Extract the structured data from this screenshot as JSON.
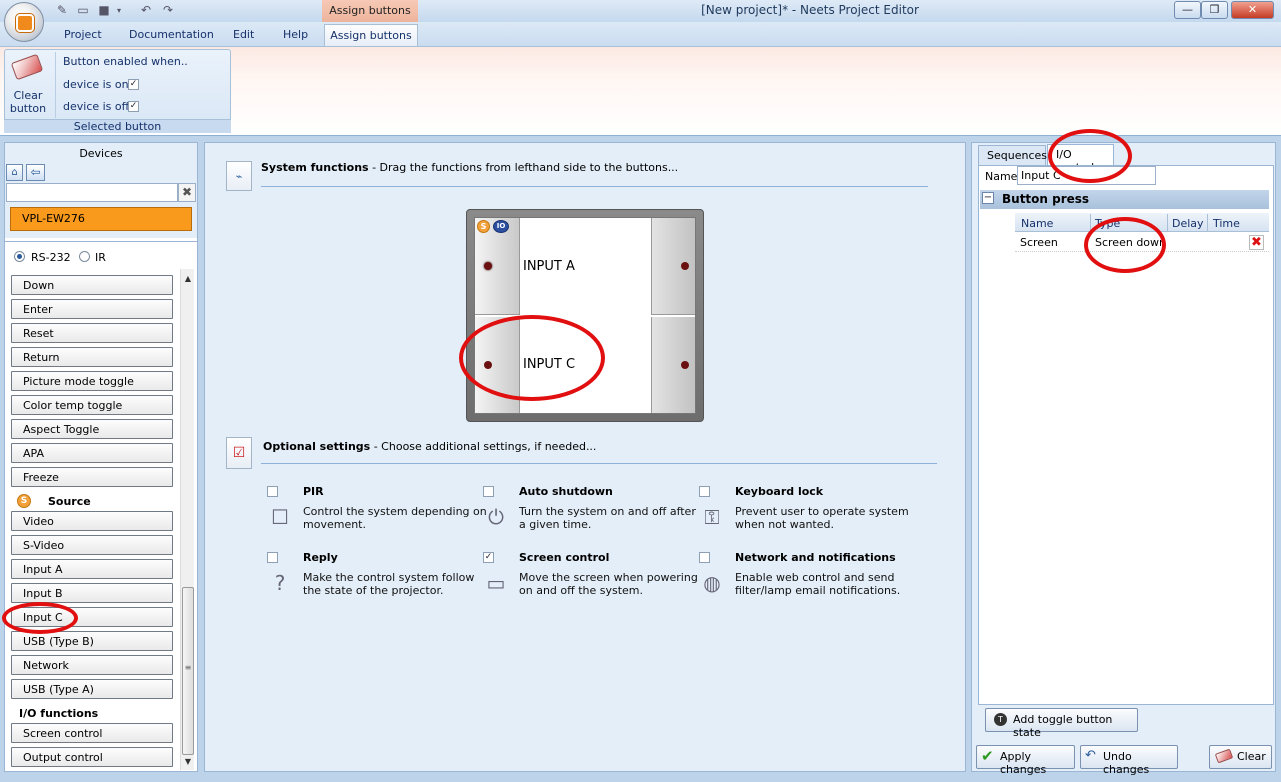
{
  "window": {
    "title": "[New project]* - Neets Project Editor",
    "context_tab": "Assign buttons",
    "min": "—",
    "max": "❐",
    "close": "✕"
  },
  "menu": {
    "items": [
      "Project",
      "Documentation",
      "Edit",
      "Help"
    ],
    "active": "Assign buttons"
  },
  "ribbon": {
    "clear_button": "Clear button",
    "clear_line1": "Clear",
    "clear_line2": "button",
    "enabled_when": "Button enabled when..",
    "device_on": "device is on",
    "device_off": "device is off",
    "group_label": "Selected button"
  },
  "devices": {
    "header": "Devices",
    "search_value": "",
    "clear_icon": "✖",
    "selected_device": "VPL-EW276",
    "radio_rs232": "RS-232",
    "radio_ir": "IR",
    "items1": [
      "Down",
      "Enter",
      "Reset",
      "Return",
      "Picture mode toggle",
      "Color temp toggle",
      "Aspect Toggle",
      "APA",
      "Freeze"
    ],
    "source_header": "Source",
    "source_items": [
      "Video",
      "S-Video",
      "Input A",
      "Input B",
      "Input C",
      "USB (Type B)",
      "Network",
      "USB (Type A)"
    ],
    "io_header": "I/O functions",
    "io_items": [
      "Screen control",
      "Output control"
    ]
  },
  "center": {
    "sys_title": "System functions",
    "sys_desc": " - Drag the functions from lefthand side to the buttons...",
    "panel_label_top": "INPUT A",
    "panel_label_bottom": "INPUT C",
    "badge_s": "S",
    "badge_io": "IO",
    "opt_title": "Optional settings",
    "opt_desc": " - Choose additional settings, if needed...",
    "options": [
      {
        "title": "PIR",
        "desc1": "Control the system depending on",
        "desc2": "movement.",
        "checked": false
      },
      {
        "title": "Auto shutdown",
        "desc1": "Turn the system on and off after",
        "desc2": "a given time.",
        "checked": false
      },
      {
        "title": "Keyboard lock",
        "desc1": "Prevent user to operate system",
        "desc2": "when not wanted.",
        "checked": false
      },
      {
        "title": "Reply",
        "desc1": "Make the control system follow",
        "desc2": "the state of the projector.",
        "checked": false
      },
      {
        "title": "Screen control",
        "desc1": "Move the screen when powering",
        "desc2": "on and off the system.",
        "checked": true
      },
      {
        "title": "Network and notifications",
        "desc1": "Enable web control and send",
        "desc2": "filter/lamp email notifications.",
        "checked": false
      }
    ]
  },
  "right": {
    "tab_sequences": "Sequences",
    "tab_io": "I/O control",
    "name_label": "Name",
    "name_value": "Input C",
    "group_title": "Button press",
    "columns": [
      "Name",
      "Type",
      "Delay",
      "Time"
    ],
    "row": {
      "name": "Screen",
      "type": "Screen down",
      "delay": "",
      "time": ""
    },
    "add_toggle": "Add toggle button state",
    "apply": "Apply changes",
    "undo": "Undo changes",
    "clear": "Clear"
  },
  "colors": {
    "accent_orange": "#f99a1c",
    "annotation_red": "#e10f0f",
    "ribbon_blue": "#15316a"
  }
}
